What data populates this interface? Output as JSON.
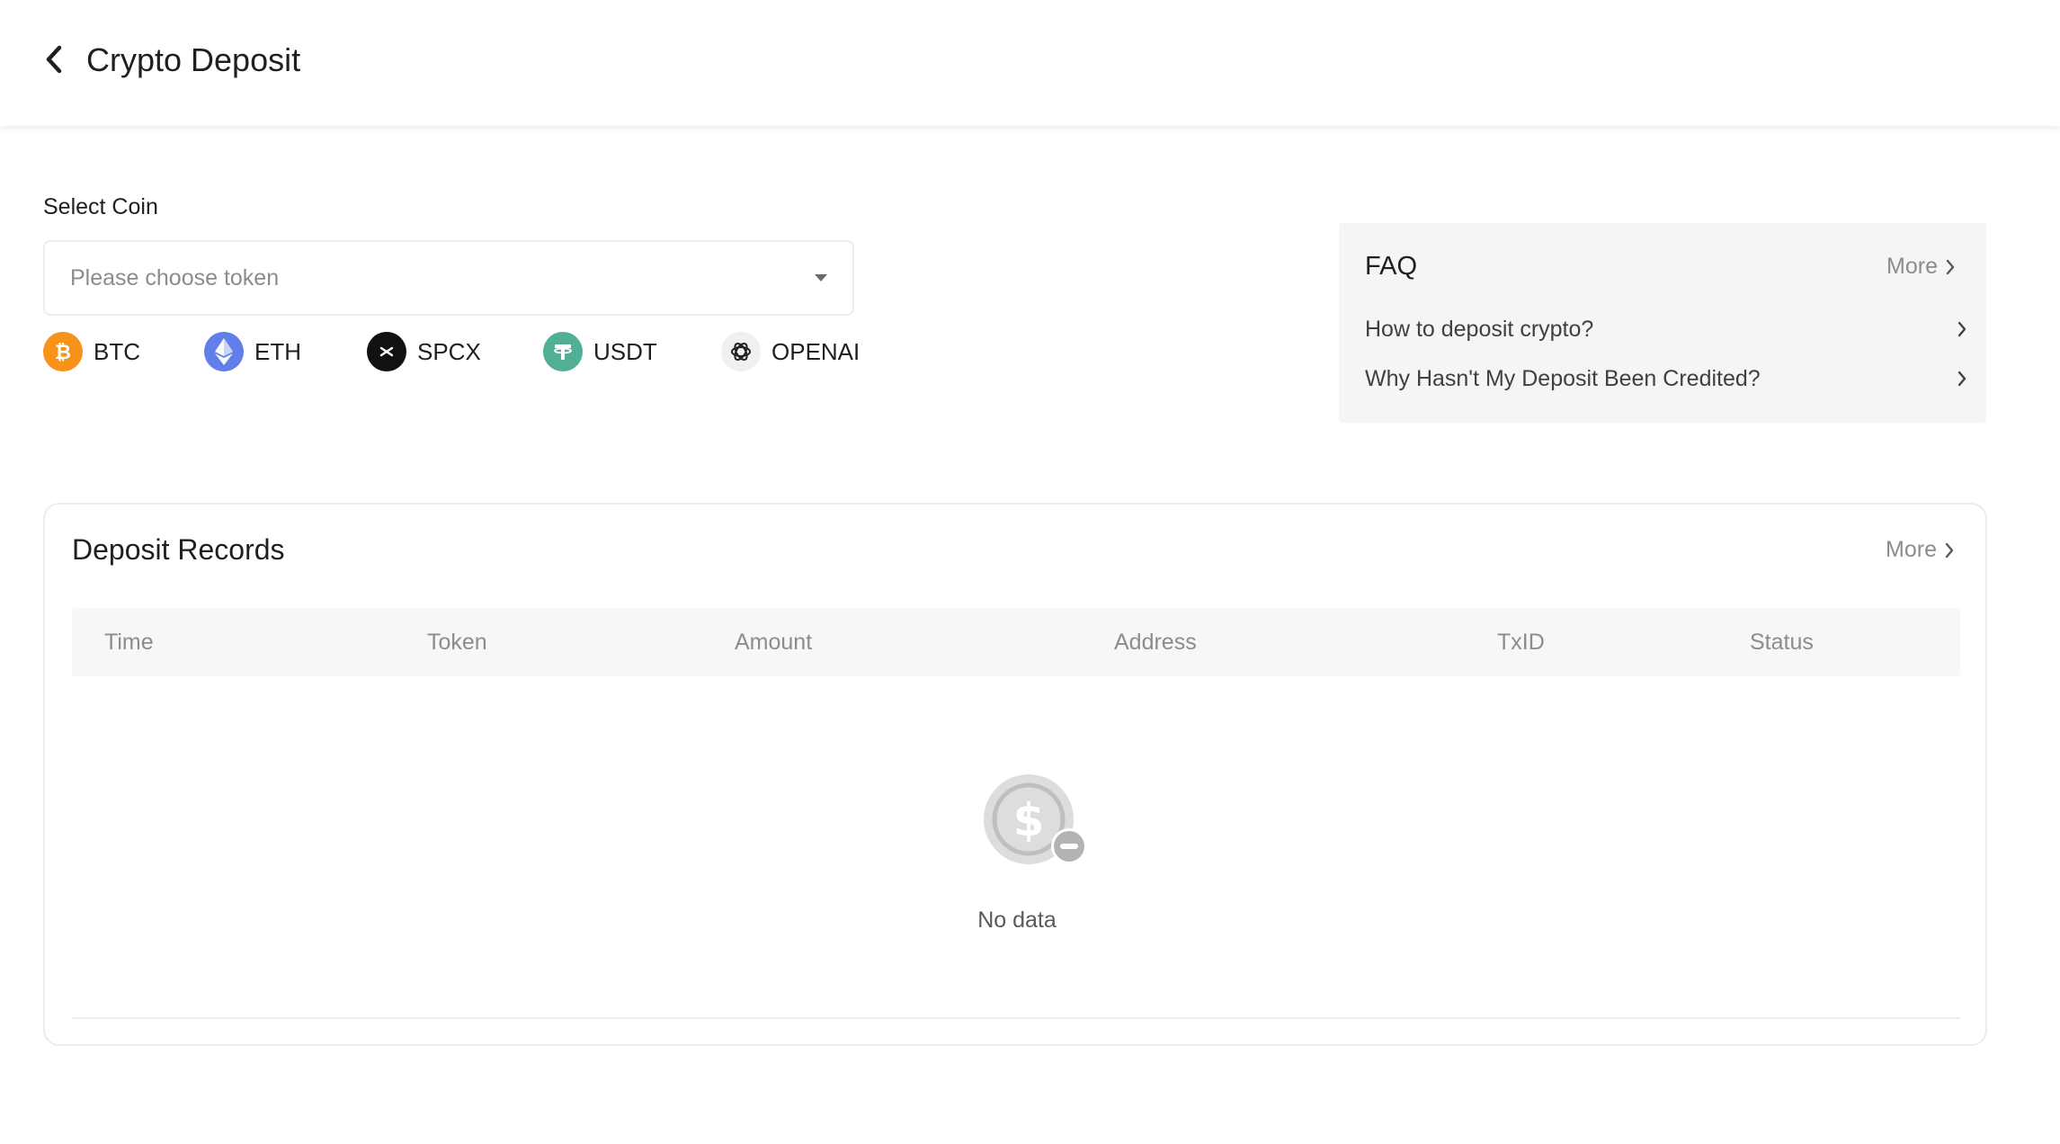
{
  "header": {
    "title": "Crypto Deposit"
  },
  "select_coin": {
    "label": "Select Coin",
    "placeholder": "Please choose token",
    "coins": [
      {
        "symbol": "BTC",
        "color": "#f7931a",
        "icon": "bitcoin-icon"
      },
      {
        "symbol": "ETH",
        "color": "#627eea",
        "icon": "ethereum-icon"
      },
      {
        "symbol": "SPCX",
        "color": "#111111",
        "icon": "spcx-icon"
      },
      {
        "symbol": "USDT",
        "color": "#50af95",
        "icon": "tether-icon"
      },
      {
        "symbol": "OPENAI",
        "color": "#f0f0f0",
        "icon": "openai-icon"
      }
    ]
  },
  "faq": {
    "title": "FAQ",
    "more_label": "More",
    "items": [
      {
        "question": "How to deposit crypto?"
      },
      {
        "question": "Why Hasn't My Deposit Been Credited?"
      }
    ]
  },
  "records": {
    "title": "Deposit Records",
    "more_label": "More",
    "columns": [
      "Time",
      "Token",
      "Amount",
      "Address",
      "TxID",
      "Status"
    ],
    "rows": [],
    "empty_text": "No data"
  }
}
